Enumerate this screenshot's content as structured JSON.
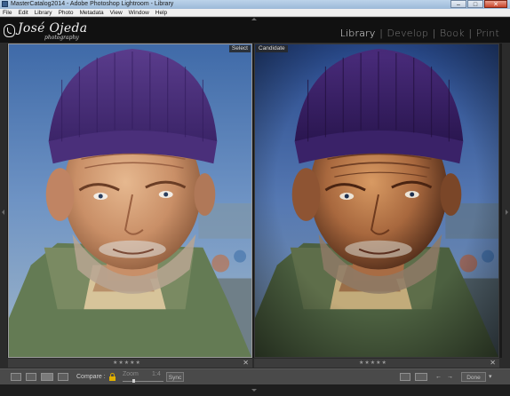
{
  "window": {
    "title": "MasterCatalog2014 - Adobe Photoshop Lightroom - Library",
    "minimize": "–",
    "maximize": "□",
    "close": "✕"
  },
  "menu": {
    "items": [
      "File",
      "Edit",
      "Library",
      "Photo",
      "Metadata",
      "View",
      "Window",
      "Help"
    ]
  },
  "identity": {
    "name": "José Ojeda",
    "subtitle": "photography",
    "modules": [
      "Library",
      "Develop",
      "Book",
      "Print"
    ],
    "separator": "|",
    "active_module": "Library"
  },
  "compare": {
    "left_label": "Select",
    "right_label": "Candidate",
    "left_stars": "★★★★★",
    "right_stars": "★★★★★",
    "close_glyph": "✕"
  },
  "toolbar": {
    "compare_label": "Compare :",
    "zoom_label": "Zoom",
    "zoom_value": "1:4",
    "sync_label": "Sync",
    "done_label": "Done",
    "swap_left": "⇆",
    "prev": "←",
    "next": "→",
    "dropdown": "▾"
  },
  "colors": {
    "accent_active": "#f2f2f2",
    "lock": "#e0b000",
    "beanie": "#4a2f7a"
  },
  "icons": {
    "grid_view": "grid-view-icon",
    "loupe_view": "loupe-view-icon",
    "compare_view": "compare-view-icon",
    "survey_view": "survey-view-icon",
    "lock": "lock-icon"
  }
}
